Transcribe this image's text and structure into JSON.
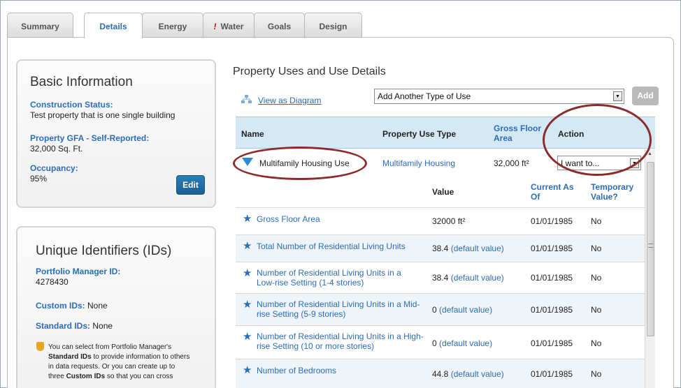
{
  "tabs": [
    {
      "label": "Summary",
      "active": false,
      "alert": false
    },
    {
      "label": "Details",
      "active": true,
      "alert": false
    },
    {
      "label": "Energy",
      "active": false,
      "alert": false
    },
    {
      "label": "Water",
      "active": false,
      "alert": true
    },
    {
      "label": "Goals",
      "active": false,
      "alert": false
    },
    {
      "label": "Design",
      "active": false,
      "alert": false
    }
  ],
  "basic_info": {
    "title": "Basic Information",
    "construction_label": "Construction Status:",
    "construction_value": "Test property that is one single building",
    "gfa_label": "Property GFA - Self-Reported:",
    "gfa_value": "32,000 Sq. Ft.",
    "occupancy_label": "Occupancy:",
    "occupancy_value": "95%",
    "edit_label": "Edit"
  },
  "ids": {
    "title": "Unique Identifiers (IDs)",
    "pm_label": "Portfolio Manager ID:",
    "pm_value": "4278430",
    "custom_label": "Custom IDs:",
    "custom_value": "None",
    "standard_label": "Standard IDs:",
    "standard_value": "None",
    "tip_line1": "You can select from Portfolio Manager's",
    "tip_bold": "Standard IDs",
    "tip_line2": "to provide information to others",
    "tip_line3": "in data requests. Or you can create up to",
    "tip_line4_pre": "three",
    "tip_bold2": "Custom IDs",
    "tip_line4_post": "so that you can cross"
  },
  "uses": {
    "title": "Property Uses and Use Details",
    "diagram_link": "View as Diagram",
    "add_select": "Add Another Type of Use",
    "add_button": "Add",
    "headers": {
      "name": "Name",
      "type": "Property Use Type",
      "gfa": "Gross Floor Area",
      "action": "Action"
    },
    "use_row": {
      "name": "Multifamily Housing Use",
      "type": "Multifamily Housing",
      "gfa": "32,000 ft²",
      "action": "I want to..."
    },
    "detail_headers": {
      "value": "Value",
      "current": "Current As Of",
      "temporary": "Temporary Value?"
    },
    "details": [
      {
        "name": "Gross Floor Area",
        "value": "32000 ft²",
        "default": "",
        "date": "01/01/1985",
        "temp": "No"
      },
      {
        "name": "Total Number of Residential Living Units",
        "value": "38.4",
        "default": "(default value)",
        "date": "01/01/1985",
        "temp": "No"
      },
      {
        "name": "Number of Residential Living Units in a Low-rise Setting (1-4 stories)",
        "value": "38.4",
        "default": "(default value)",
        "date": "01/01/1985",
        "temp": "No"
      },
      {
        "name": "Number of Residential Living Units in a Mid-rise Setting (5-9 stories)",
        "value": "0",
        "default": "(default value)",
        "date": "01/01/1985",
        "temp": "No"
      },
      {
        "name": "Number of Residential Living Units in a High-rise Setting (10 or more stories)",
        "value": "0",
        "default": "(default value)",
        "date": "01/01/1985",
        "temp": "No"
      },
      {
        "name": "Number of Bedrooms",
        "value": "44.8",
        "default": "(default value)",
        "date": "01/01/1985",
        "temp": "No"
      }
    ]
  },
  "colors": {
    "link_blue": "#2c6db5",
    "header_blue": "#d4e8f5",
    "annotation_red": "#8b2b2b",
    "edit_button": "#1f6ea5"
  }
}
